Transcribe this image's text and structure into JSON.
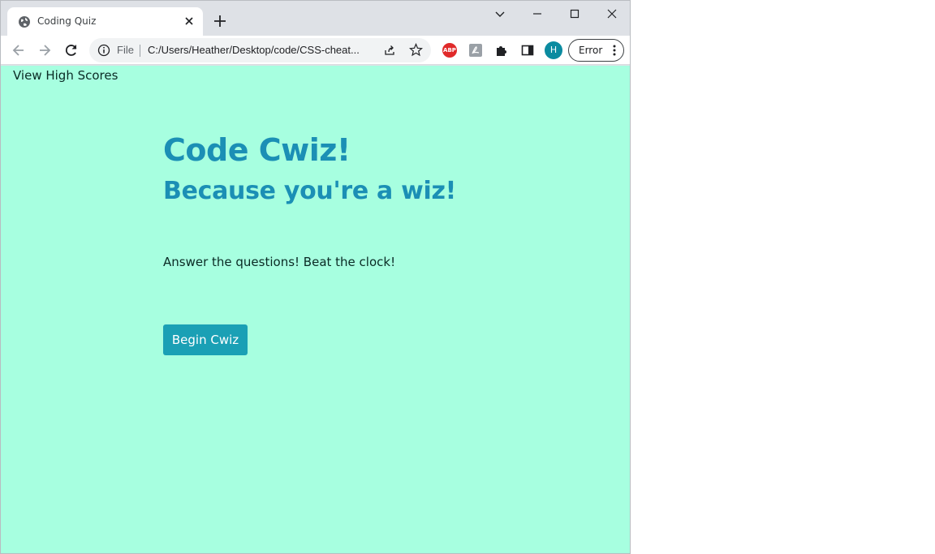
{
  "browser": {
    "tab_title": "Coding Quiz",
    "new_tab_glyph": "+",
    "omnibox": {
      "file_label": "File",
      "url": "C:/Users/Heather/Desktop/code/CSS-cheat..."
    },
    "extensions": {
      "abp_label": "ABP"
    },
    "profile_initial": "H",
    "error_chip_label": "Error",
    "colors": {
      "tabstrip": "#dee1e6",
      "avatar": "#0b8ba0",
      "abp": "#e02a2a"
    }
  },
  "page": {
    "nav_link": "View High Scores",
    "title": "Code Cwiz!",
    "subtitle": "Because you're a wiz!",
    "instructions": "Answer the questions! Beat the clock!",
    "start_button": "Begin Cwiz",
    "colors": {
      "background": "#a7ffe0",
      "heading": "#1b8fb5",
      "button": "#1aa0b5"
    }
  }
}
